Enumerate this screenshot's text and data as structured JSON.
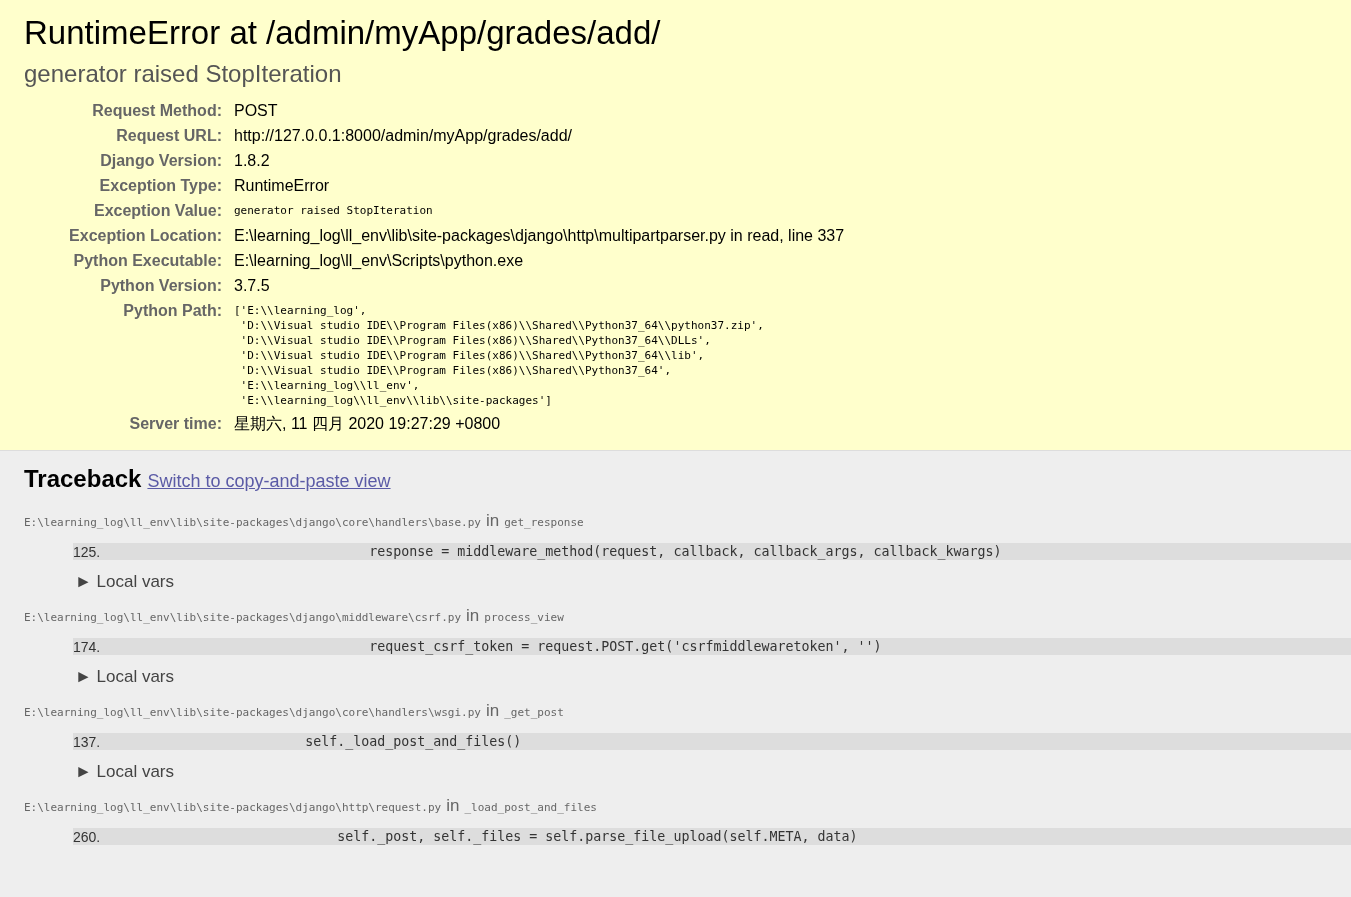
{
  "summary": {
    "title": "RuntimeError at /admin/myApp/grades/add/",
    "subtitle": "generator raised StopIteration",
    "meta": [
      {
        "kind": "text",
        "label": "Request Method:",
        "value": "POST"
      },
      {
        "kind": "text",
        "label": "Request URL:",
        "value": "http://127.0.0.1:8000/admin/myApp/grades/add/"
      },
      {
        "kind": "text",
        "label": "Django Version:",
        "value": "1.8.2"
      },
      {
        "kind": "text",
        "label": "Exception Type:",
        "value": "RuntimeError"
      },
      {
        "kind": "code",
        "label": "Exception Value:",
        "value": "generator raised StopIteration"
      },
      {
        "kind": "text",
        "label": "Exception Location:",
        "value": "E:\\learning_log\\ll_env\\lib\\site-packages\\django\\http\\multipartparser.py in read, line 337"
      },
      {
        "kind": "text",
        "label": "Python Executable:",
        "value": "E:\\learning_log\\ll_env\\Scripts\\python.exe"
      },
      {
        "kind": "text",
        "label": "Python Version:",
        "value": "3.7.5"
      },
      {
        "kind": "lines",
        "label": "Python Path:",
        "lines": [
          "['E:\\\\learning_log',",
          " 'D:\\\\Visual studio IDE\\\\Program Files(x86)\\\\Shared\\\\Python37_64\\\\python37.zip',",
          " 'D:\\\\Visual studio IDE\\\\Program Files(x86)\\\\Shared\\\\Python37_64\\\\DLLs',",
          " 'D:\\\\Visual studio IDE\\\\Program Files(x86)\\\\Shared\\\\Python37_64\\\\lib',",
          " 'D:\\\\Visual studio IDE\\\\Program Files(x86)\\\\Shared\\\\Python37_64',",
          " 'E:\\\\learning_log\\\\ll_env',",
          " 'E:\\\\learning_log\\\\ll_env\\\\lib\\\\site-packages']"
        ]
      },
      {
        "kind": "text",
        "label": "Server time:",
        "value": "星期六, 11 四月 2020 19:27:29 +0800"
      }
    ]
  },
  "traceback": {
    "title": "Traceback",
    "switch_link": "Switch to copy-and-paste view",
    "frames": [
      {
        "file": "E:\\learning_log\\ll_env\\lib\\site-packages\\django\\core\\handlers\\base.py",
        "in": "in",
        "function": "get_response",
        "line_number": "125.",
        "code": "                                response = middleware_method(request, callback, callback_args, callback_kwargs)",
        "local_vars": "► Local vars"
      },
      {
        "file": "E:\\learning_log\\ll_env\\lib\\site-packages\\django\\middleware\\csrf.py",
        "in": "in",
        "function": "process_view",
        "line_number": "174.",
        "code": "                                request_csrf_token = request.POST.get('csrfmiddlewaretoken', '')",
        "local_vars": "► Local vars"
      },
      {
        "file": "E:\\learning_log\\ll_env\\lib\\site-packages\\django\\core\\handlers\\wsgi.py",
        "in": "in",
        "function": "_get_post",
        "line_number": "137.",
        "code": "                        self._load_post_and_files()",
        "local_vars": "► Local vars"
      },
      {
        "file": "E:\\learning_log\\ll_env\\lib\\site-packages\\django\\http\\request.py",
        "in": "in",
        "function": "_load_post_and_files",
        "line_number": "260.",
        "code": "                            self._post, self._files = self.parse_file_upload(self.META, data)"
      }
    ]
  }
}
